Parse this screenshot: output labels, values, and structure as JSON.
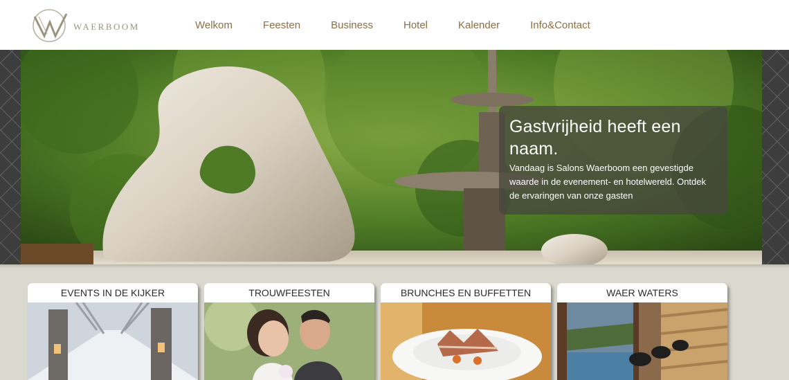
{
  "logo": {
    "text": "WAERBOOM",
    "icon": "waerboom-w-logo"
  },
  "nav": {
    "items": [
      {
        "label": "Welkom"
      },
      {
        "label": "Feesten"
      },
      {
        "label": "Business"
      },
      {
        "label": "Hotel"
      },
      {
        "label": "Kalender"
      },
      {
        "label": "Info&Contact"
      }
    ]
  },
  "hero": {
    "title": "Gastvrijheid heeft een naam.",
    "text": "Vandaag is Salons Waerboom een gevestigde waarde in de evenement- en hotelwereld. Ontdek de ervaringen van onze gasten"
  },
  "cards": [
    {
      "title": "EVENTS IN DE KIJKER",
      "image": "winter-avenue-gate-photo"
    },
    {
      "title": "TROUWFEESTEN",
      "image": "wedding-couple-photo"
    },
    {
      "title": "BRUNCHES EN BUFFETTEN",
      "image": "plated-fish-dish-photo"
    },
    {
      "title": "WAER WATERS",
      "image": "spa-pool-photo"
    }
  ],
  "colors": {
    "nav": "#8c6e44",
    "logo": "#9a9580",
    "background": "#d9d9cf",
    "band": "#3d3d3d"
  }
}
